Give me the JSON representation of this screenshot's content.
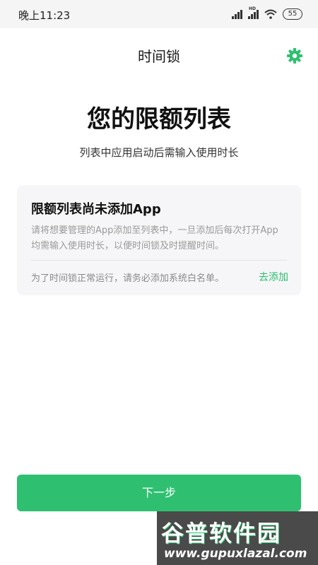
{
  "status_bar": {
    "time": "晚上11:23",
    "hd": "HD",
    "battery": "55"
  },
  "header": {
    "title": "时间锁"
  },
  "hero": {
    "title": "您的限额列表",
    "subtitle": "列表中应用启动后需输入使用时长"
  },
  "card": {
    "title": "限额列表尚未添加App",
    "description": "请将想要管理的App添加至列表中，一旦添加后每次打开App均需输入使用时长，以便时间锁及时提醒时间。",
    "note": "为了时间锁正常运行，请务必添加系统白名单。",
    "link": "去添加"
  },
  "actions": {
    "next": "下一步"
  },
  "watermark": {
    "name": "谷普软件园",
    "url": "www.gupuxlazal.com"
  },
  "colors": {
    "accent": "#2ec070",
    "link": "#2bbd6f",
    "card_bg": "#f6f6f8",
    "status_bg": "#f5f5f5"
  },
  "icons": {
    "settings": "gear-icon",
    "signal": "signal-icon",
    "wifi": "wifi-icon",
    "battery": "battery-icon"
  }
}
